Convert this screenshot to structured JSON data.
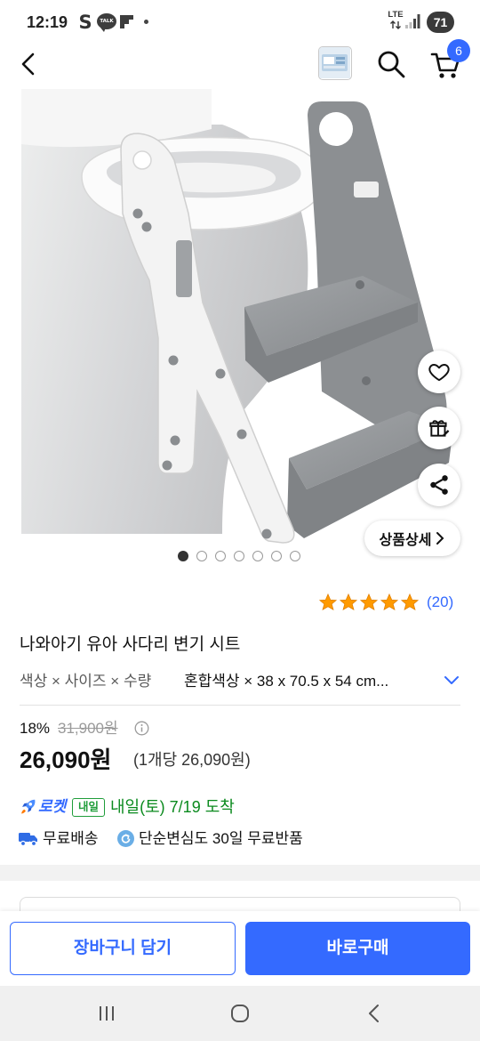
{
  "status_bar": {
    "time": "12:19",
    "samsung_logo_letter": "S",
    "kakaotalk_logo_text": "TALK",
    "network": "LTE",
    "battery": "71",
    "icons": [
      "samsung-icon",
      "kakaotalk-icon",
      "flipboard-icon",
      "notification-dot-icon",
      "lte-icon",
      "signal-icon",
      "battery-icon"
    ]
  },
  "header": {
    "icons": [
      "chevron-left-icon",
      "product-thumbnail",
      "search-icon",
      "cart-icon"
    ],
    "cart_count": "6"
  },
  "gallery": {
    "detail_label": "상품상세",
    "slide_count": 7,
    "active_slide": 0,
    "side_actions": [
      "heart-icon",
      "gift-icon",
      "share-icon"
    ]
  },
  "rating": {
    "stars": 5,
    "max_stars": 5,
    "count": "(20)"
  },
  "product": {
    "title": "나와아기 유아 사다리 변기 시트"
  },
  "options": {
    "label": "색상 × 사이즈 × 수량",
    "value": "혼합색상 × 38 x 70.5 x 54 cm..."
  },
  "price": {
    "discount": "18%",
    "original": "31,900원",
    "sale": "26,090원",
    "unit_price": "(1개당 26,090원)"
  },
  "delivery": {
    "rocket_label": "로켓",
    "tomorrow_badge": "내일",
    "arrival": "내일(토) 7/19 도착",
    "free_shipping": "무료배송",
    "returns": "단순변심도 30일 무료반품"
  },
  "actions": {
    "add_to_cart": "장바구니 담기",
    "buy_now": "바로구매"
  },
  "nav_bar": {
    "icons": [
      "recent-apps-icon",
      "home-icon",
      "back-icon"
    ]
  },
  "colors": {
    "brand_blue": "#346aff",
    "star_orange": "#ff9a00",
    "arrival_green": "#0b8a1e",
    "text_primary": "#111111",
    "text_secondary": "#5a5a5a"
  }
}
